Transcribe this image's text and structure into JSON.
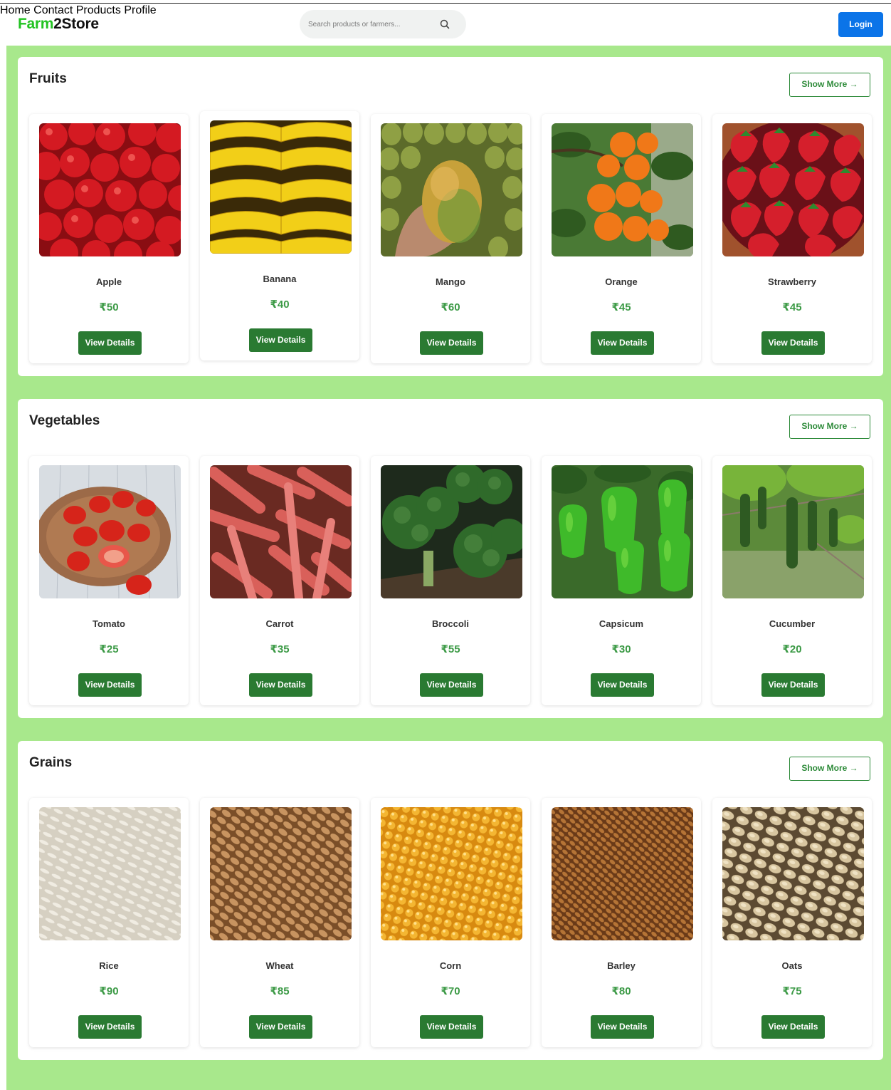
{
  "brand": {
    "part1": "Farm",
    "part2": "2Store",
    "color1": "#22c322",
    "color2": "#111111"
  },
  "search": {
    "placeholder": "Search products or farmers...",
    "icon": "search-icon"
  },
  "nav": {
    "home": "Home",
    "contact": "Contact",
    "products": "Products",
    "profile": "Profile",
    "login": "Login"
  },
  "colors": {
    "accent": "#2a7a32",
    "price": "#3c9a46",
    "background": "#a8e88c",
    "login": "#0b74e8"
  },
  "sections": [
    {
      "title": "Fruits",
      "show_more": "Show More →",
      "products": [
        {
          "name": "Apple",
          "price": "₹50",
          "button": "View Details"
        },
        {
          "name": "Banana",
          "price": "₹40",
          "button": "View Details"
        },
        {
          "name": "Mango",
          "price": "₹60",
          "button": "View Details"
        },
        {
          "name": "Orange",
          "price": "₹45",
          "button": "View Details"
        },
        {
          "name": "Strawberry",
          "price": "₹45",
          "button": "View Details"
        }
      ]
    },
    {
      "title": "Vegetables",
      "show_more": "Show More →",
      "products": [
        {
          "name": "Tomato",
          "price": "₹25",
          "button": "View Details"
        },
        {
          "name": "Carrot",
          "price": "₹35",
          "button": "View Details"
        },
        {
          "name": "Broccoli",
          "price": "₹55",
          "button": "View Details"
        },
        {
          "name": "Capsicum",
          "price": "₹30",
          "button": "View Details"
        },
        {
          "name": "Cucumber",
          "price": "₹20",
          "button": "View Details"
        }
      ]
    },
    {
      "title": "Grains",
      "show_more": "Show More →",
      "products": [
        {
          "name": "Rice",
          "price": "₹90",
          "button": "View Details"
        },
        {
          "name": "Wheat",
          "price": "₹85",
          "button": "View Details"
        },
        {
          "name": "Corn",
          "price": "₹70",
          "button": "View Details"
        },
        {
          "name": "Barley",
          "price": "₹80",
          "button": "View Details"
        },
        {
          "name": "Oats",
          "price": "₹75",
          "button": "View Details"
        }
      ]
    }
  ]
}
